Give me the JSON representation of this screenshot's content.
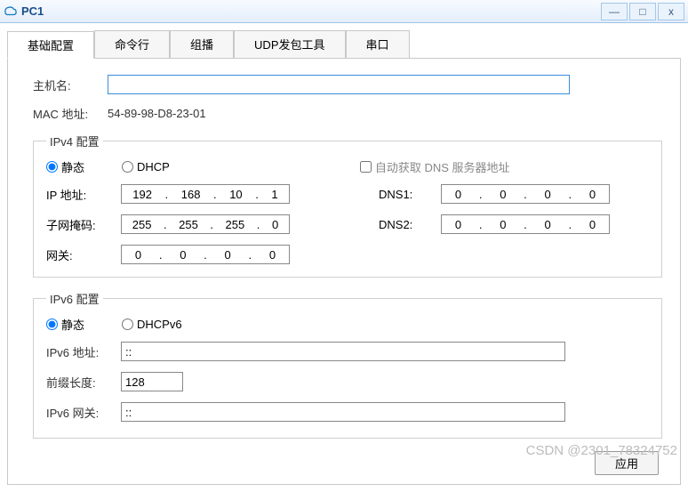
{
  "window": {
    "title": "PC1",
    "buttons": {
      "min": "—",
      "max": "□",
      "close": "x"
    }
  },
  "tabs": [
    "基础配置",
    "命令行",
    "组播",
    "UDP发包工具",
    "串口"
  ],
  "active_tab": 0,
  "basic": {
    "hostname_label": "主机名:",
    "hostname_value": "",
    "mac_label": "MAC 地址:",
    "mac_value": "54-89-98-D8-23-01"
  },
  "ipv4": {
    "legend": "IPv4 配置",
    "radio_static": "静态",
    "radio_dhcp": "DHCP",
    "mode": "static",
    "auto_dns_label": "自动获取 DNS 服务器地址",
    "auto_dns_checked": false,
    "ip_label": "IP 地址:",
    "ip": [
      "192",
      "168",
      "10",
      "1"
    ],
    "mask_label": "子网掩码:",
    "mask": [
      "255",
      "255",
      "255",
      "0"
    ],
    "gw_label": "网关:",
    "gw": [
      "0",
      "0",
      "0",
      "0"
    ],
    "dns1_label": "DNS1:",
    "dns1": [
      "0",
      "0",
      "0",
      "0"
    ],
    "dns2_label": "DNS2:",
    "dns2": [
      "0",
      "0",
      "0",
      "0"
    ]
  },
  "ipv6": {
    "legend": "IPv6 配置",
    "radio_static": "静态",
    "radio_dhcp": "DHCPv6",
    "mode": "static",
    "addr_label": "IPv6 地址:",
    "addr": "::",
    "prefix_label": "前缀长度:",
    "prefix": "128",
    "gw_label": "IPv6 网关:",
    "gw": "::"
  },
  "apply_label": "应用",
  "watermark": "CSDN @2301_78324752"
}
